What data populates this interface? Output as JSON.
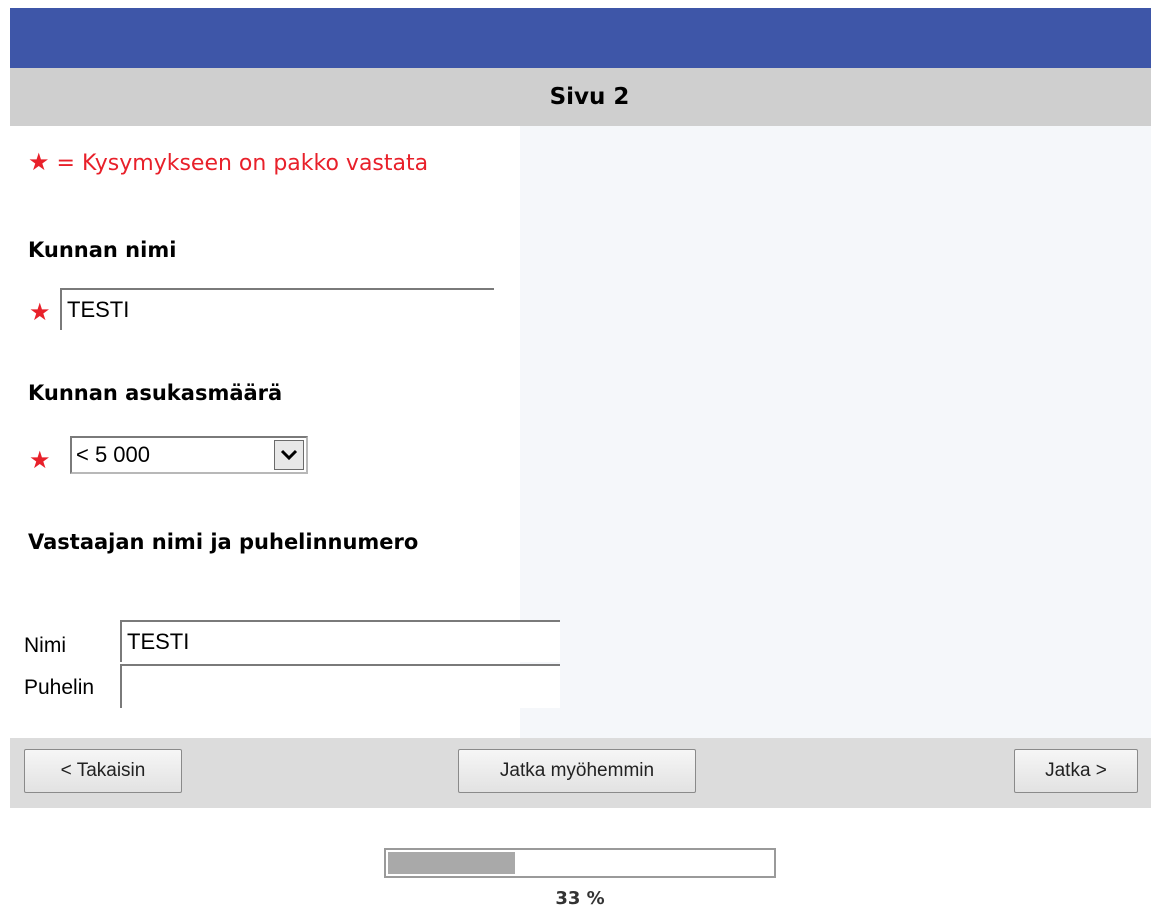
{
  "header": {
    "page_title": "Sivu 2"
  },
  "form": {
    "required_note": "= Kysymykseen on pakko vastata",
    "required_symbol": "★",
    "question_municipality": {
      "label": "Kunnan nimi",
      "value": "TESTI",
      "required": true
    },
    "question_population": {
      "label": "Kunnan asukasmäärä",
      "selected_value": "< 5 000",
      "required": true
    },
    "question_respondent": {
      "label": "Vastaajan nimi ja puhelinnumero",
      "name_label": "Nimi",
      "name_value": "TESTI",
      "phone_label": "Puhelin",
      "phone_value": ""
    }
  },
  "navigation": {
    "back_label": "< Takaisin",
    "later_label": "Jatka myöhemmin",
    "next_label": "Jatka >"
  },
  "progress": {
    "percent": 33,
    "label": "33 %"
  },
  "colors": {
    "header_blue": "#3e56a8",
    "required_red": "#e8202a",
    "bar_gray": "#cfcfcf"
  }
}
